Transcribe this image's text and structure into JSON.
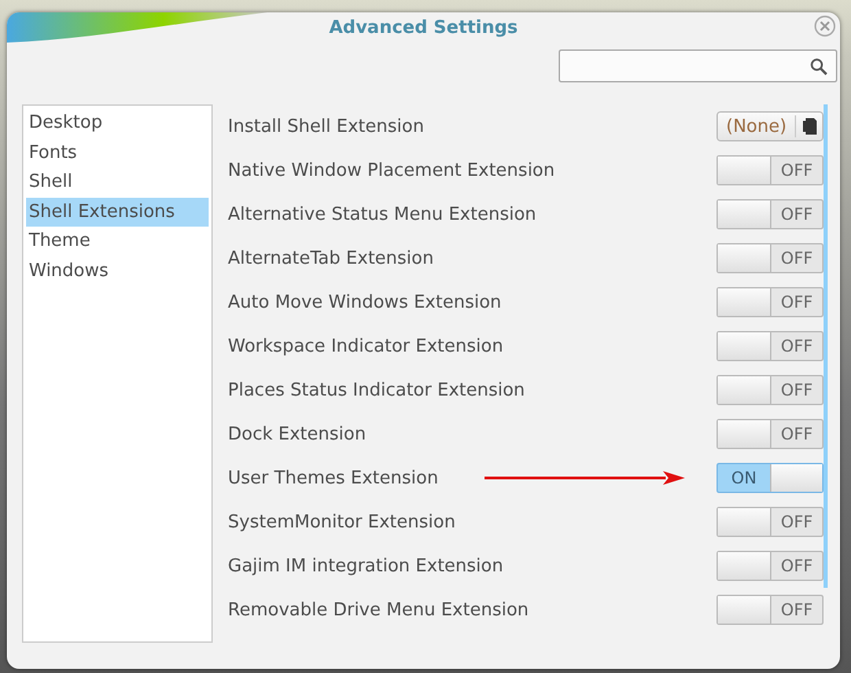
{
  "window": {
    "title": "Advanced Settings"
  },
  "sidebar": {
    "items": [
      {
        "label": "Desktop",
        "selected": false
      },
      {
        "label": "Fonts",
        "selected": false
      },
      {
        "label": "Shell",
        "selected": false
      },
      {
        "label": "Shell Extensions",
        "selected": true
      },
      {
        "label": "Theme",
        "selected": false
      },
      {
        "label": "Windows",
        "selected": false
      }
    ]
  },
  "settings": [
    {
      "kind": "combo",
      "label": "Install Shell Extension",
      "value": "(None)"
    },
    {
      "kind": "switch",
      "label": "Native Window Placement Extension",
      "on": false,
      "state_text": "OFF",
      "marked": false
    },
    {
      "kind": "switch",
      "label": "Alternative Status Menu Extension",
      "on": false,
      "state_text": "OFF",
      "marked": false
    },
    {
      "kind": "switch",
      "label": "AlternateTab Extension",
      "on": false,
      "state_text": "OFF",
      "marked": false
    },
    {
      "kind": "switch",
      "label": "Auto Move Windows Extension",
      "on": false,
      "state_text": "OFF",
      "marked": false
    },
    {
      "kind": "switch",
      "label": "Workspace Indicator Extension",
      "on": false,
      "state_text": "OFF",
      "marked": false
    },
    {
      "kind": "switch",
      "label": "Places Status Indicator Extension",
      "on": false,
      "state_text": "OFF",
      "marked": false
    },
    {
      "kind": "switch",
      "label": "Dock Extension",
      "on": false,
      "state_text": "OFF",
      "marked": false
    },
    {
      "kind": "switch",
      "label": "User Themes Extension",
      "on": true,
      "state_text": "ON",
      "marked": true
    },
    {
      "kind": "switch",
      "label": "SystemMonitor Extension",
      "on": false,
      "state_text": "OFF",
      "marked": false
    },
    {
      "kind": "switch",
      "label": "Gajim IM integration Extension",
      "on": false,
      "state_text": "OFF",
      "marked": false
    },
    {
      "kind": "switch",
      "label": "Removable Drive Menu Extension",
      "on": false,
      "state_text": "OFF",
      "marked": false
    }
  ]
}
